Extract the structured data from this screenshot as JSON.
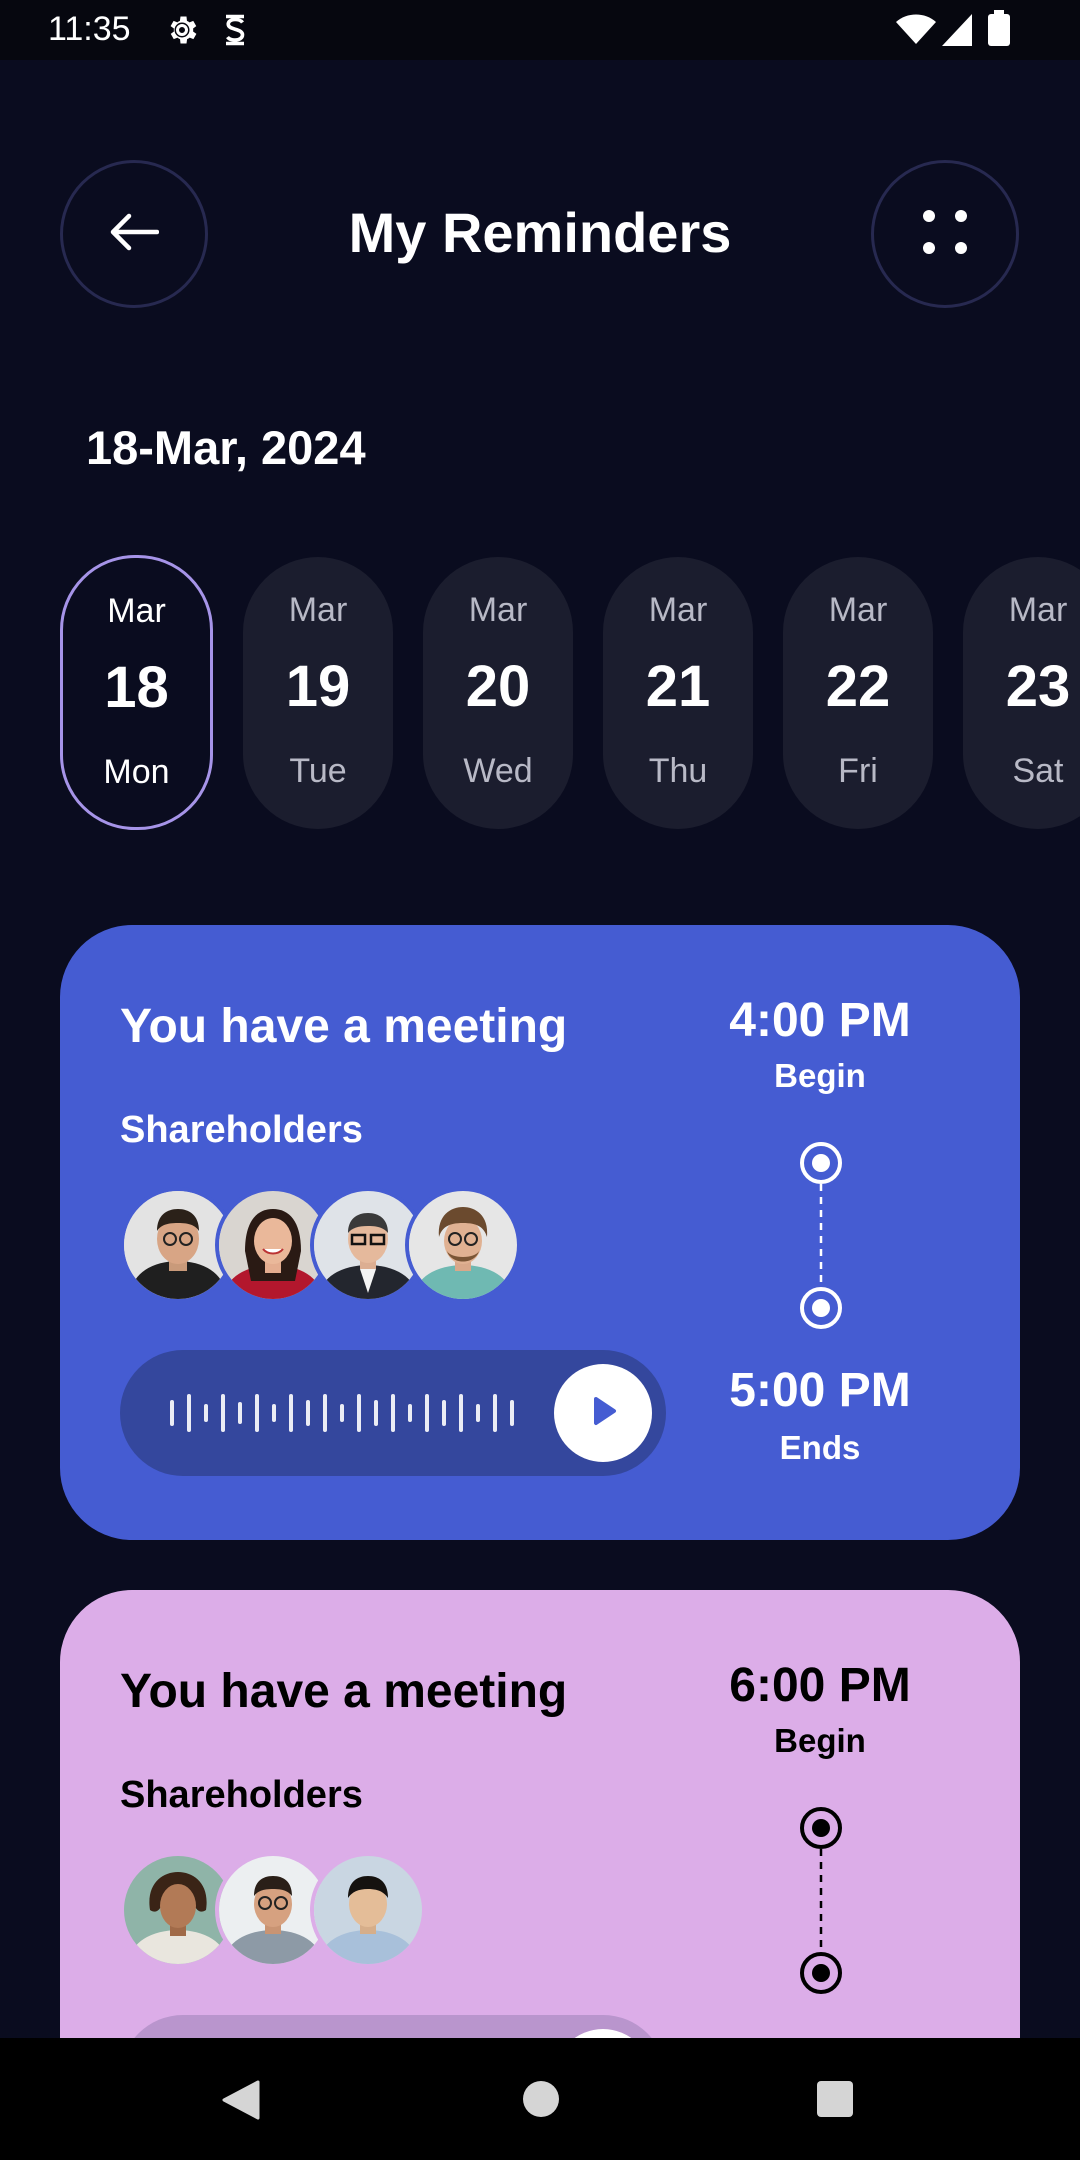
{
  "status_bar": {
    "time": "11:35",
    "left_icons": [
      "gear-icon",
      "s-shield-icon"
    ],
    "right_icons": [
      "wifi-icon",
      "signal-icon",
      "battery-icon"
    ]
  },
  "header": {
    "title": "My Reminders",
    "back_icon": "arrow-left-icon",
    "menu_icon": "four-dots-icon"
  },
  "selected_date": "18-Mar, 2024",
  "days": [
    {
      "month": "Mar",
      "day": "18",
      "weekday": "Mon",
      "selected": true
    },
    {
      "month": "Mar",
      "day": "19",
      "weekday": "Tue",
      "selected": false
    },
    {
      "month": "Mar",
      "day": "20",
      "weekday": "Wed",
      "selected": false
    },
    {
      "month": "Mar",
      "day": "21",
      "weekday": "Thu",
      "selected": false
    },
    {
      "month": "Mar",
      "day": "22",
      "weekday": "Fri",
      "selected": false
    },
    {
      "month": "Mar",
      "day": "23",
      "weekday": "Sat",
      "selected": false
    }
  ],
  "meetings": [
    {
      "title": "You have a meeting",
      "subtitle": "Shareholders",
      "begin_time": "4:00 PM",
      "begin_label": "Begin",
      "end_time": "5:00 PM",
      "end_label": "Ends",
      "participants": 4,
      "color": "#455cd2"
    },
    {
      "title": "You have a meeting",
      "subtitle": "Shareholders",
      "begin_time": "6:00 PM",
      "begin_label": "Begin",
      "participants": 3,
      "color": "#dcade8"
    }
  ],
  "nav_bar": {
    "icons": [
      "back-triangle-icon",
      "home-circle-icon",
      "recents-square-icon"
    ]
  },
  "colors": {
    "background": "#0a0c1f",
    "pill": "#1b1d2e",
    "pill_selected_border": "#a694e8",
    "card_blue": "#455cd2",
    "card_pink": "#dcade8"
  }
}
